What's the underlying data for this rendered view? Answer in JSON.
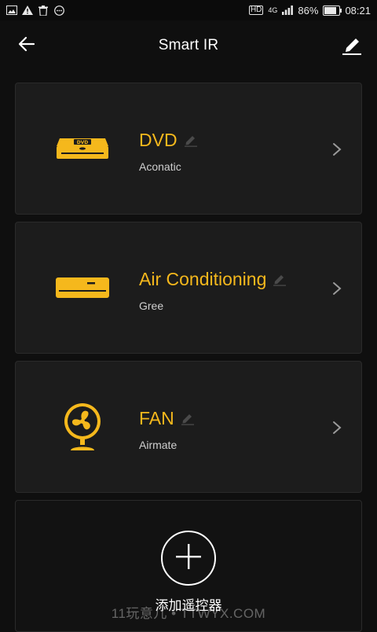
{
  "status_bar": {
    "battery_percent": "86%",
    "time": "08:21",
    "network": "4G",
    "hd_label": "HD",
    "left_icons": [
      "image-icon",
      "warning-icon",
      "trash-icon",
      "messenger-icon"
    ],
    "battery_level": 0.86
  },
  "header": {
    "title": "Smart IR",
    "back_icon": "back-arrow-icon",
    "edit_icon": "pencil-icon"
  },
  "devices": [
    {
      "name": "DVD",
      "brand": "Aconatic",
      "icon": "dvd-player-icon"
    },
    {
      "name": "Air Conditioning",
      "brand": "Gree",
      "icon": "air-conditioner-icon"
    },
    {
      "name": "FAN",
      "brand": "Airmate",
      "icon": "fan-icon"
    }
  ],
  "add_remote": {
    "label": "添加遥控器",
    "icon": "plus-icon"
  },
  "watermark": "11玩意儿 • TTWYX.COM",
  "colors": {
    "accent": "#f5b81c",
    "background": "#0f0f0f",
    "card": "#1c1c1c",
    "text_secondary": "#cfcfcf"
  }
}
